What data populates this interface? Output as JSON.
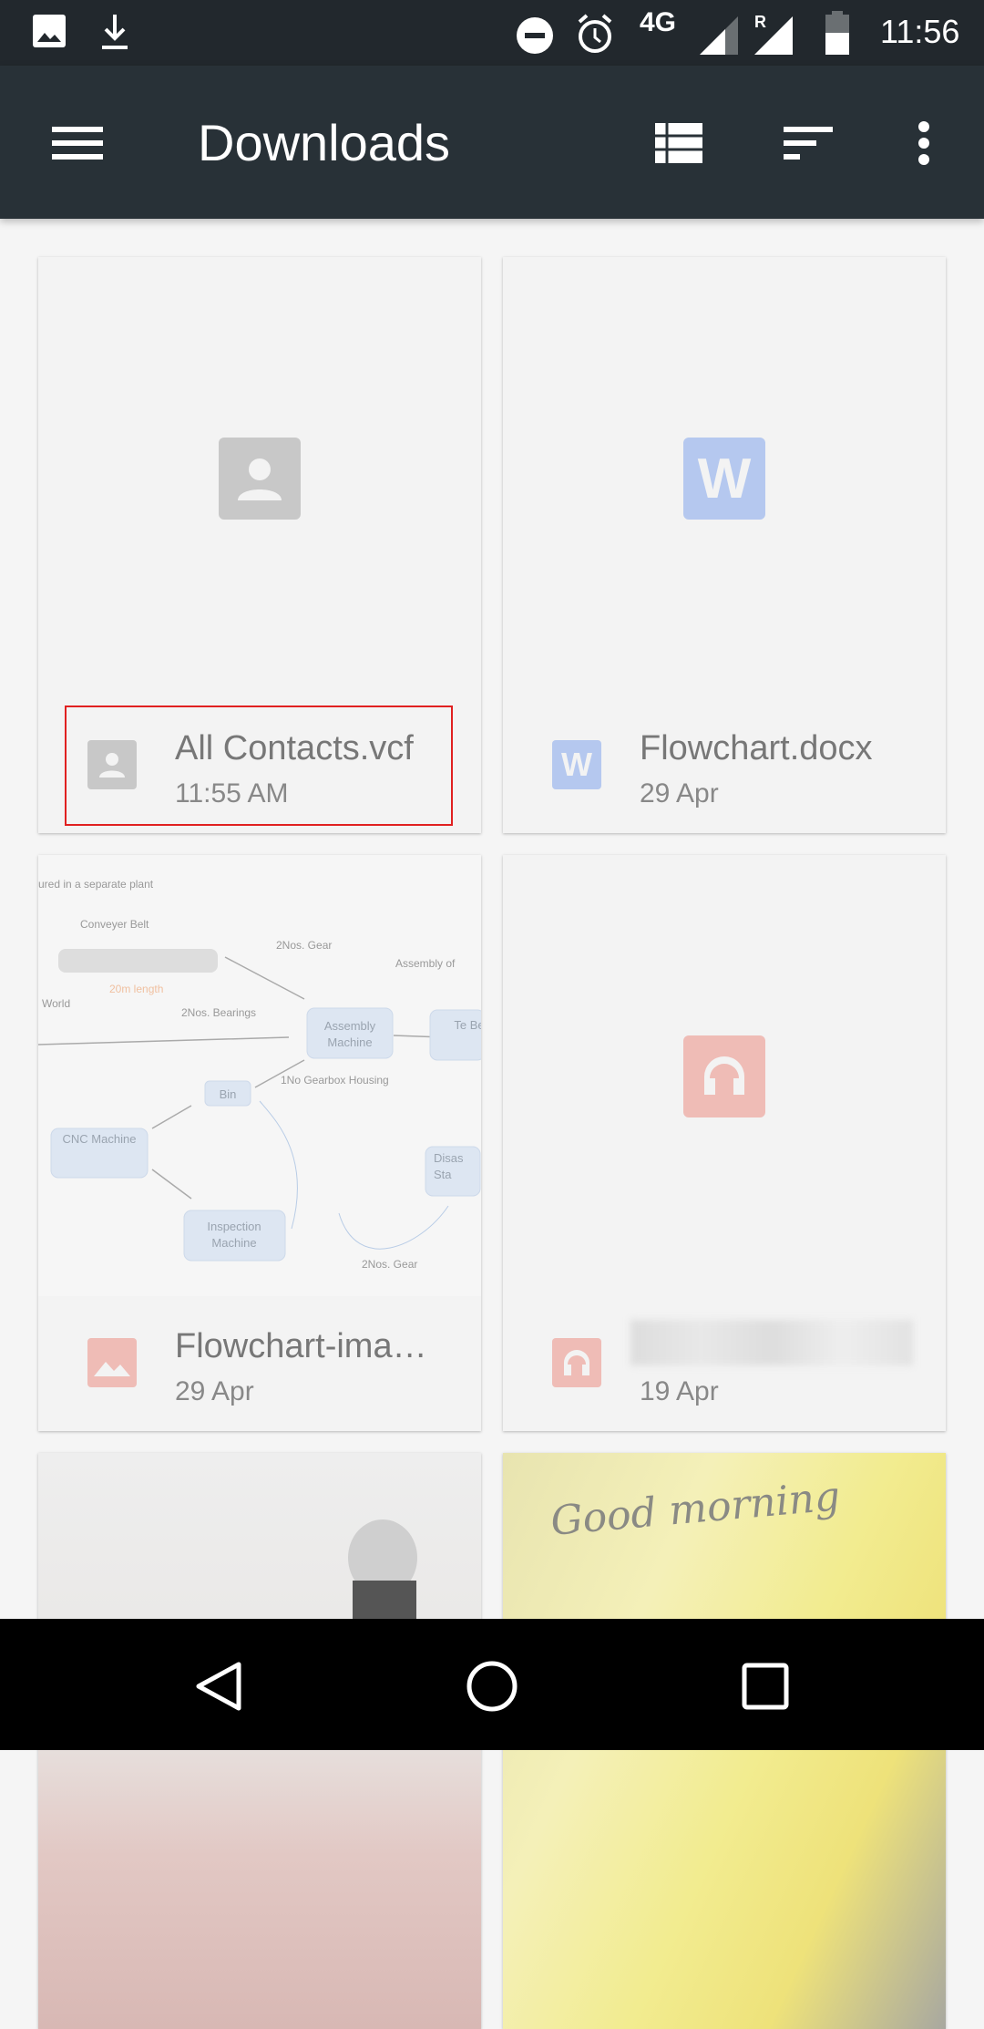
{
  "status_bar": {
    "network": "4G",
    "roaming": "R",
    "time": "11:56",
    "icons": [
      "image-icon",
      "download-icon",
      "dnd-icon",
      "alarm-icon",
      "signal-icon",
      "signal-roaming-icon",
      "battery-icon"
    ]
  },
  "toolbar": {
    "title": "Downloads",
    "icons": [
      "menu-icon",
      "list-view-icon",
      "sort-icon",
      "more-vert-icon"
    ]
  },
  "files": [
    {
      "name": "All Contacts.vcf",
      "date": "11:55 AM",
      "type": "contact",
      "color": "#c8c8c8",
      "highlighted": true
    },
    {
      "name": "Flowchart.docx",
      "date": "29 Apr",
      "type": "word",
      "color": "#b5c8ef",
      "glyph": "W"
    },
    {
      "name": "Flowchart-ima…",
      "date": "29 Apr",
      "type": "image",
      "color": "#efbcb6"
    },
    {
      "name": "",
      "date": "19 Apr",
      "type": "audio",
      "color": "#efbcb6",
      "name_blurred": true
    },
    {
      "name": "",
      "date": "",
      "type": "photo"
    },
    {
      "name": "",
      "date": "",
      "type": "photo",
      "image_text": "Good morning"
    }
  ],
  "flowchart": {
    "labels": [
      "ured in a separate plant",
      "Conveyer Belt",
      "2Nos. Gear",
      "Assembly of",
      "20m length",
      "World",
      "2Nos. Bearings",
      "Assembly Machine",
      "Te Be",
      "Bin",
      "1No Gearbox Housing",
      "CNC Machine",
      "Disas Sta",
      "Inspection Machine",
      "2Nos. Gear"
    ]
  },
  "nav": {
    "icons": [
      "back-icon",
      "home-icon",
      "recents-icon"
    ]
  }
}
